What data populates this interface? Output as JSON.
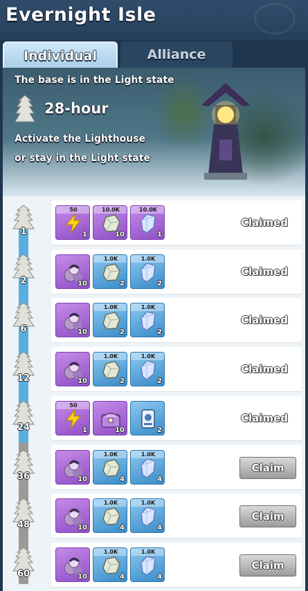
{
  "header": {
    "title": "Evernight Isle"
  },
  "tabs": [
    {
      "label": "Individual",
      "active": true
    },
    {
      "label": "Alliance",
      "active": false
    }
  ],
  "banner": {
    "state_text": "The base is in the Light state",
    "hours": "28-hour",
    "hint_line1": "Activate the Lighthouse",
    "hint_line2": "or stay in the Light state"
  },
  "progress": {
    "reached_tier": 24
  },
  "tiers": [
    {
      "milestone": "1",
      "status": "Claimed",
      "items": [
        {
          "icon": "lightning-icon",
          "color": "purple",
          "top": "50",
          "qty": "1"
        },
        {
          "icon": "stone-icon",
          "color": "purple",
          "top": "10.0K",
          "qty": "10"
        },
        {
          "icon": "crystal-icon",
          "color": "purple",
          "top": "10.0K",
          "qty": "1"
        }
      ]
    },
    {
      "milestone": "2",
      "status": "Claimed",
      "items": [
        {
          "icon": "hero-icon",
          "color": "purple",
          "top": "",
          "qty": "10"
        },
        {
          "icon": "stone-icon",
          "color": "blue",
          "top": "1.0K",
          "qty": "2"
        },
        {
          "icon": "crystal-icon",
          "color": "blue",
          "top": "1.0K",
          "qty": "2"
        }
      ]
    },
    {
      "milestone": "6",
      "status": "Claimed",
      "items": [
        {
          "icon": "hero-icon",
          "color": "purple",
          "top": "",
          "qty": "10"
        },
        {
          "icon": "stone-icon",
          "color": "blue",
          "top": "1.0K",
          "qty": "2"
        },
        {
          "icon": "crystal-icon",
          "color": "blue",
          "top": "1.0K",
          "qty": "2"
        }
      ]
    },
    {
      "milestone": "12",
      "status": "Claimed",
      "items": [
        {
          "icon": "hero-icon",
          "color": "purple",
          "top": "",
          "qty": "10"
        },
        {
          "icon": "stone-icon",
          "color": "blue",
          "top": "1.0K",
          "qty": "2"
        },
        {
          "icon": "crystal-icon",
          "color": "blue",
          "top": "1.0K",
          "qty": "2"
        }
      ]
    },
    {
      "milestone": "24",
      "status": "Claimed",
      "items": [
        {
          "icon": "lightning-icon",
          "color": "purple",
          "top": "50",
          "qty": "1"
        },
        {
          "icon": "chest-icon",
          "color": "purple",
          "top": "",
          "qty": "10"
        },
        {
          "icon": "card-icon",
          "color": "blue",
          "top": "",
          "qty": "2"
        }
      ]
    },
    {
      "milestone": "36",
      "status": "Claim",
      "items": [
        {
          "icon": "hero-icon",
          "color": "purple",
          "top": "",
          "qty": "10"
        },
        {
          "icon": "stone-icon",
          "color": "blue",
          "top": "1.0K",
          "qty": "4"
        },
        {
          "icon": "crystal-icon",
          "color": "blue",
          "top": "1.0K",
          "qty": "4"
        }
      ]
    },
    {
      "milestone": "48",
      "status": "Claim",
      "items": [
        {
          "icon": "hero-icon",
          "color": "purple",
          "top": "",
          "qty": "10"
        },
        {
          "icon": "stone-icon",
          "color": "blue",
          "top": "1.0K",
          "qty": "4"
        },
        {
          "icon": "crystal-icon",
          "color": "blue",
          "top": "1.0K",
          "qty": "4"
        }
      ]
    },
    {
      "milestone": "60",
      "status": "Claim",
      "items": [
        {
          "icon": "hero-icon",
          "color": "purple",
          "top": "",
          "qty": "10"
        },
        {
          "icon": "stone-icon",
          "color": "blue",
          "top": "1.0K",
          "qty": "4"
        },
        {
          "icon": "crystal-icon",
          "color": "blue",
          "top": "1.0K",
          "qty": "4"
        }
      ]
    }
  ],
  "colors": {
    "track_fill": "#59aee0",
    "track_empty": "#9a9a9a",
    "purple_item": "#a86bd6",
    "blue_item": "#5aa6de"
  }
}
